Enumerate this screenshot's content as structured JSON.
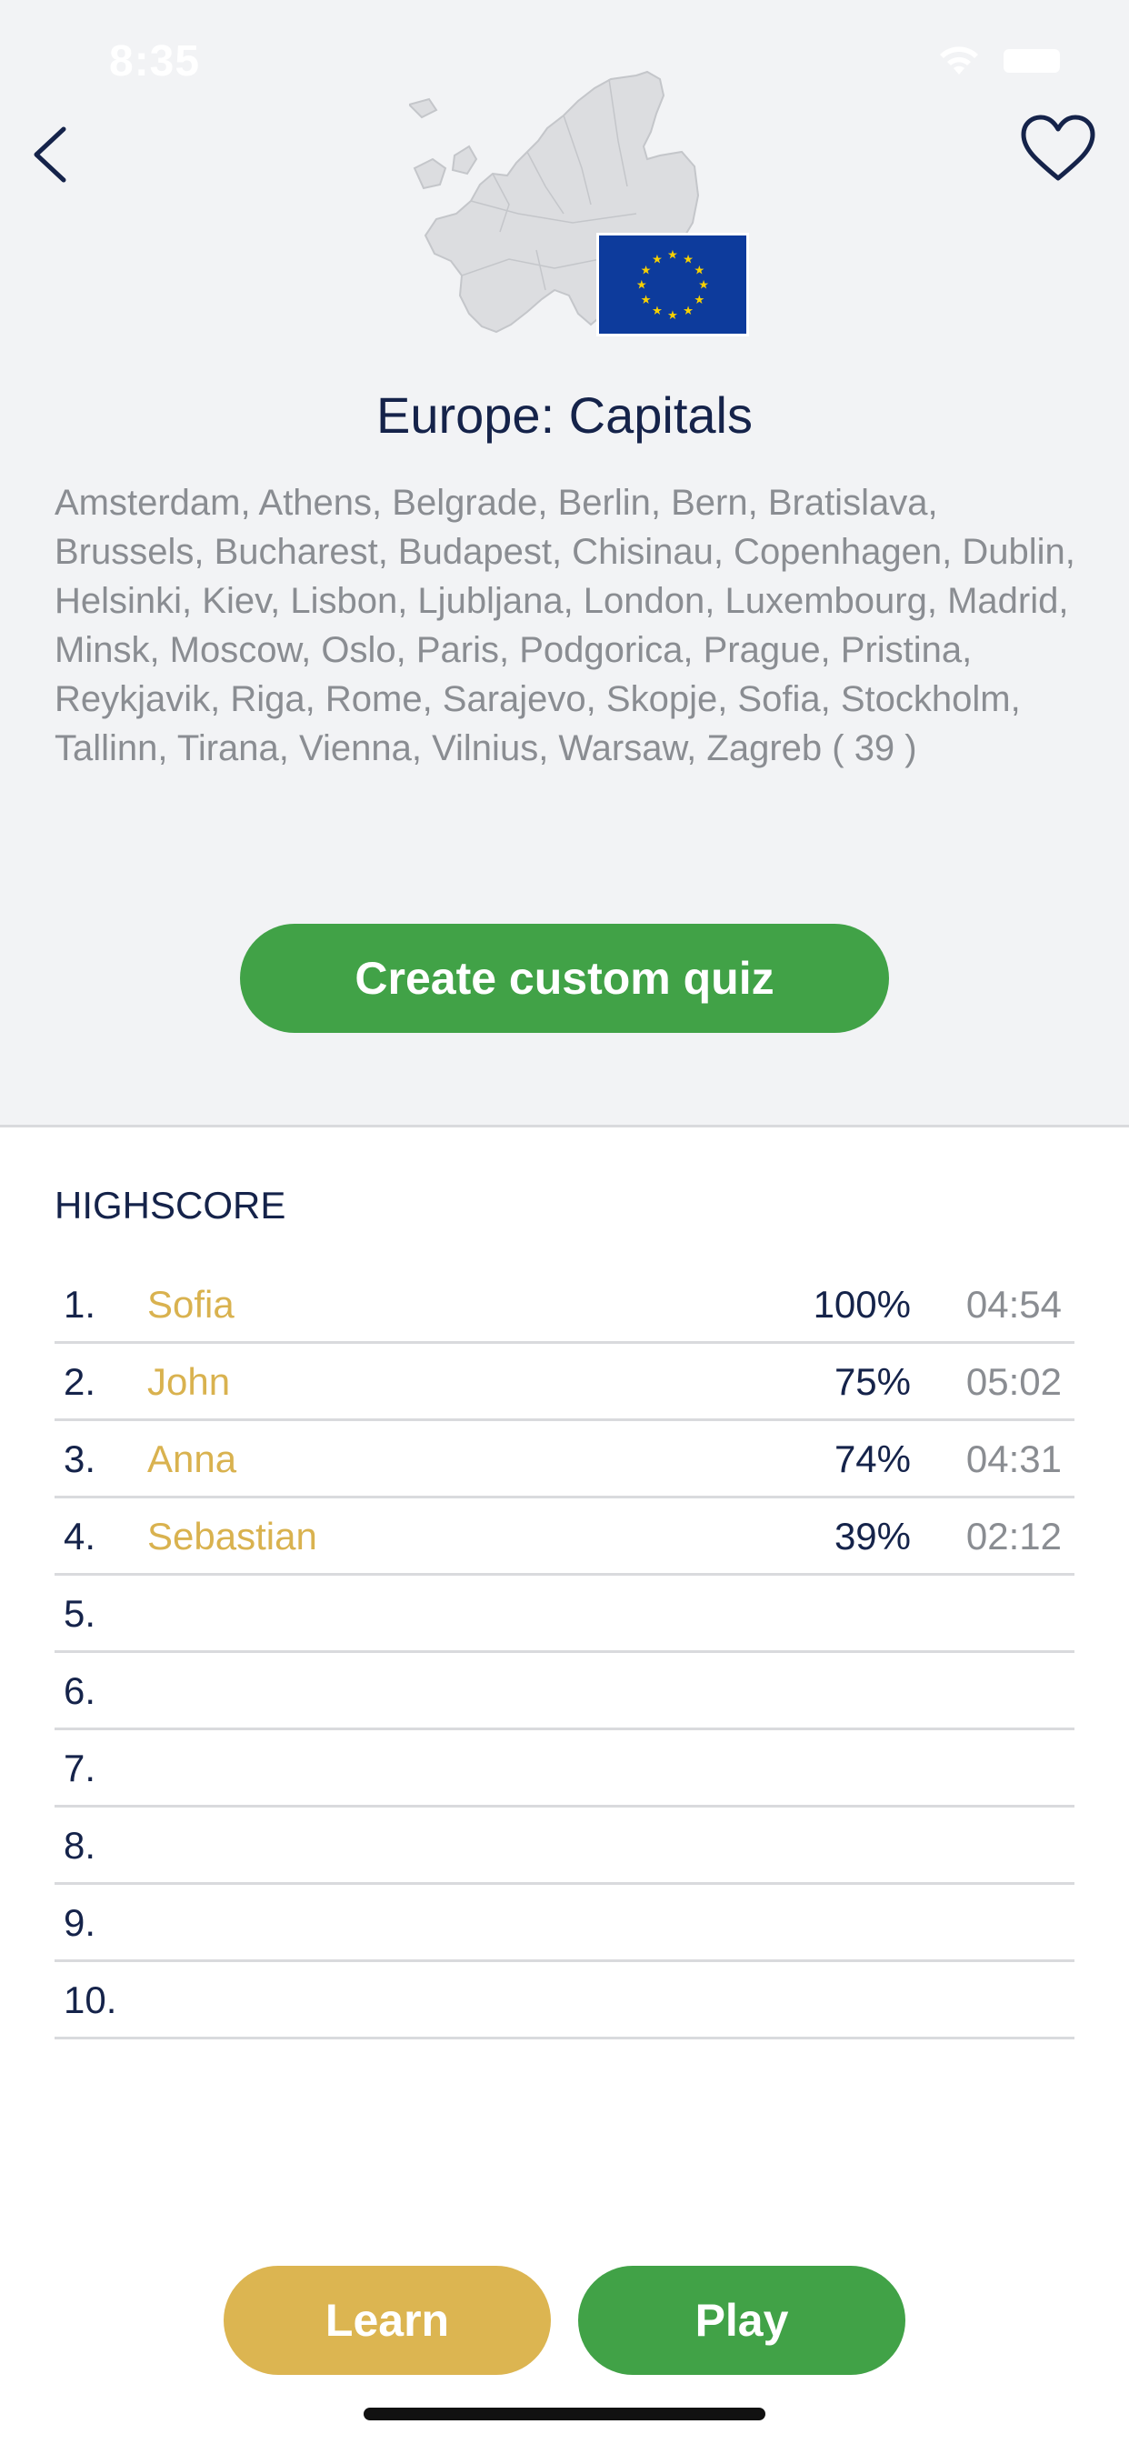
{
  "status_bar": {
    "time": "8:35"
  },
  "header": {
    "title": "Europe: Capitals",
    "capitals_text": "Amsterdam, Athens, Belgrade, Berlin, Bern, Bratislava, Brussels, Bucharest, Budapest, Chisinau, Copenhagen, Dublin, Helsinki, Kiev, Lisbon, Ljubljana, London, Luxembourg, Madrid, Minsk, Moscow, Oslo, Paris, Podgorica, Prague, Pristina, Reykjavik, Riga, Rome, Sarajevo, Skopje, Sofia, Stockholm, Tallinn, Tirana, Vienna, Vilnius, Warsaw, Zagreb ( 39 )",
    "icons": {
      "back": "chevron-left-icon",
      "favorite": "heart-icon",
      "map": "europe-map-icon",
      "flag": "eu-flag-icon"
    }
  },
  "actions": {
    "custom_quiz_label": "Create custom quiz"
  },
  "highscore": {
    "heading": "HIGHSCORE",
    "rows": [
      {
        "rank": "1.",
        "name": "Sofia",
        "score": "100%",
        "time": "04:54"
      },
      {
        "rank": "2.",
        "name": "John",
        "score": "75%",
        "time": "05:02"
      },
      {
        "rank": "3.",
        "name": "Anna",
        "score": "74%",
        "time": "04:31"
      },
      {
        "rank": "4.",
        "name": "Sebastian",
        "score": "39%",
        "time": "02:12"
      },
      {
        "rank": "5.",
        "name": "",
        "score": "",
        "time": ""
      },
      {
        "rank": "6.",
        "name": "",
        "score": "",
        "time": ""
      },
      {
        "rank": "7.",
        "name": "",
        "score": "",
        "time": ""
      },
      {
        "rank": "8.",
        "name": "",
        "score": "",
        "time": ""
      },
      {
        "rank": "9.",
        "name": "",
        "score": "",
        "time": ""
      },
      {
        "rank": "10.",
        "name": "",
        "score": "",
        "time": ""
      }
    ]
  },
  "footer": {
    "learn_label": "Learn",
    "play_label": "Play"
  },
  "colors": {
    "navy": "#15234a",
    "green": "#41a247",
    "gold": "#dcb551",
    "grey_text": "#8a8d92",
    "top_background": "#f2f3f5",
    "eu_blue": "#0d3b9c",
    "eu_star": "#f7d000"
  }
}
